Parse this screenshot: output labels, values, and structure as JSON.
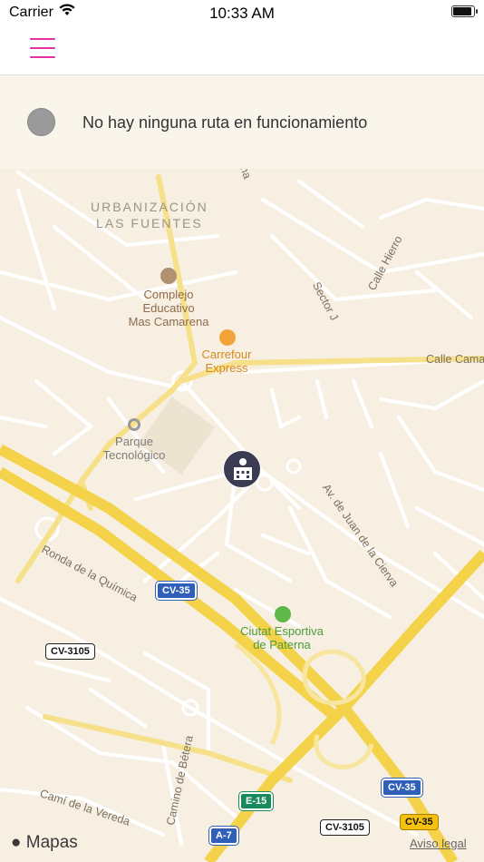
{
  "status": {
    "carrier": "Carrier",
    "time": "10:33 AM"
  },
  "banner": {
    "message": "No hay ninguna ruta en funcionamiento"
  },
  "map": {
    "area": {
      "line1": "URBANIZACIÓN",
      "line2": "LAS FUENTES"
    },
    "pois": {
      "school": {
        "line1": "Complejo",
        "line2": "Educativo",
        "line3": "Mas Camarena"
      },
      "carrefour": {
        "line1": "Carrefour",
        "line2": "Express"
      },
      "park": {
        "line1": "Parque",
        "line2": "Tecnológico"
      },
      "sports": {
        "line1": "Ciutat Esportiva",
        "line2": "de Paterna"
      }
    },
    "streets": {
      "calle_hierro": "Calle Hierro",
      "sector_j": "Sector J",
      "calle_camaron": "Calle Camaro",
      "juan_cierva": "Av. de Juan de la Cierva",
      "ronda_quimica": "Ronda de la Química",
      "camino_betera": "Camino de Bétera",
      "cami_vereda": "Camí de la Vereda",
      "street_n": "na"
    },
    "shields": {
      "cv35_a": "CV-35",
      "cv3105_a": "CV-3105",
      "e15": "E-15",
      "a7": "A-7",
      "cv3105_b": "CV-3105",
      "cv35_b": "CV-35",
      "cv35_c": "CV-35"
    },
    "brand": "Mapas",
    "legal": "Aviso legal"
  },
  "colors": {
    "accent": "#e62fa0",
    "map_bg": "#f7f0e2",
    "road_major": "#f4d24a",
    "pin_bg": "#3b3c52"
  }
}
